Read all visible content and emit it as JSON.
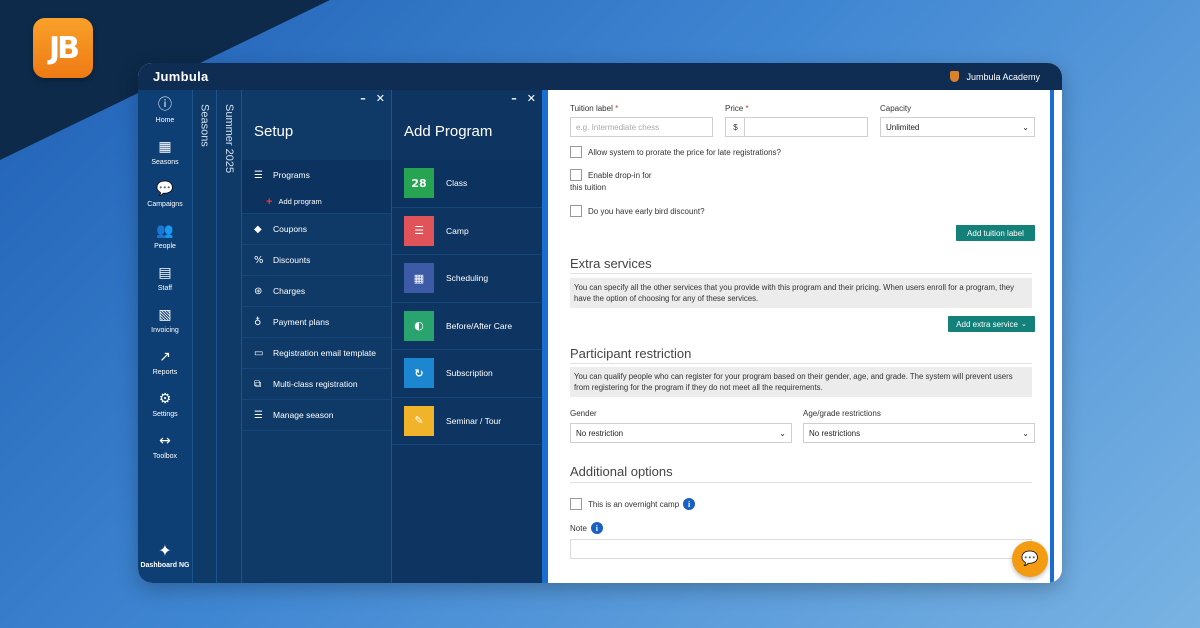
{
  "logo": {
    "text": "JB"
  },
  "app": {
    "title": "Jumbula",
    "academy": "Jumbula Academy"
  },
  "nav": [
    {
      "label": "Home",
      "icon": "home-icon",
      "glyph": "ⓘ"
    },
    {
      "label": "Seasons",
      "icon": "calendar-icon",
      "glyph": "▦"
    },
    {
      "label": "Campaigns",
      "icon": "chat-bubble-icon",
      "glyph": "💬"
    },
    {
      "label": "People",
      "icon": "people-icon",
      "glyph": "👥"
    },
    {
      "label": "Staff",
      "icon": "staff-badge-icon",
      "glyph": "▤"
    },
    {
      "label": "Invoicing",
      "icon": "invoice-icon",
      "glyph": "▧"
    },
    {
      "label": "Reports",
      "icon": "chart-icon",
      "glyph": "↗"
    },
    {
      "label": "Settings",
      "icon": "gears-icon",
      "glyph": "⚙"
    },
    {
      "label": "Toolbox",
      "icon": "arrows-icon",
      "glyph": "↔"
    }
  ],
  "nav_bottom": {
    "label": "Dashboard NG",
    "icon": "magic-wand-icon",
    "glyph": "✦"
  },
  "vtabs": {
    "seasons": "Seasons",
    "season_name": "Summer 2025"
  },
  "setup": {
    "title": "Setup",
    "items": [
      {
        "label": "Programs",
        "icon": "list-icon",
        "glyph": "☰"
      },
      {
        "label": "Coupons",
        "icon": "tag-icon",
        "glyph": "◆"
      },
      {
        "label": "Discounts",
        "icon": "percent-icon",
        "glyph": "%"
      },
      {
        "label": "Charges",
        "icon": "coins-icon",
        "glyph": "⊛"
      },
      {
        "label": "Payment plans",
        "icon": "money-bag-icon",
        "glyph": "♁"
      },
      {
        "label": "Registration email template",
        "icon": "email-template-icon",
        "glyph": "▭"
      },
      {
        "label": "Multi-class registration",
        "icon": "multi-class-icon",
        "glyph": "⧉"
      },
      {
        "label": "Manage season",
        "icon": "list-icon",
        "glyph": "☰"
      }
    ],
    "sub_item": "Add program"
  },
  "add_program": {
    "title": "Add Program",
    "items": [
      {
        "label": "Class",
        "icon": "calendar-28-icon",
        "color": "#27a451",
        "glyph": "28"
      },
      {
        "label": "Camp",
        "icon": "camp-list-icon",
        "color": "#e05459",
        "glyph": "☰"
      },
      {
        "label": "Scheduling",
        "icon": "schedule-icon",
        "color": "#3d5aa6",
        "glyph": "▦"
      },
      {
        "label": "Before/After Care",
        "icon": "care-icon",
        "color": "#2aa46e",
        "glyph": "◐"
      },
      {
        "label": "Subscription",
        "icon": "subscription-icon",
        "color": "#1c87d0",
        "glyph": "↻"
      },
      {
        "label": "Seminar / Tour",
        "icon": "seminar-icon",
        "color": "#f1b32a",
        "glyph": "✎"
      }
    ]
  },
  "form": {
    "tuition_label": "Tuition label",
    "tuition_placeholder": "e.g. Intermediate chess",
    "price_label": "Price",
    "currency": "$",
    "capacity_label": "Capacity",
    "capacity_value": "Unlimited",
    "required_mark": "*",
    "prorate": "Allow system to prorate the price for late registrations?",
    "dropin_line1": "Enable drop-in for",
    "dropin_line2": "this tuition",
    "early_bird": "Do you have early bird discount?",
    "add_tuition_btn": "Add tuition label",
    "extra_title": "Extra services",
    "extra_info": "You can specify all the other services that you provide with this program and their pricing. When users enroll for a program, they have the option of choosing for any of these services.",
    "add_extra_btn": "Add extra service",
    "restriction_title": "Participant restriction",
    "restriction_info": "You can qualify people who can register for your program based on their gender, age, and grade. The system will prevent users from registering for the program if they do not meet all the requirements.",
    "gender_label": "Gender",
    "gender_value": "No restriction",
    "age_label": "Age/grade restrictions",
    "age_value": "No restrictions",
    "additional_title": "Additional options",
    "overnight": "This is an overnight camp",
    "note_label": "Note"
  },
  "colors": {
    "brand_dark": "#0f2d52",
    "sidebar": "#0e3f74",
    "accent": "#14807a",
    "chat": "#f39c12"
  }
}
